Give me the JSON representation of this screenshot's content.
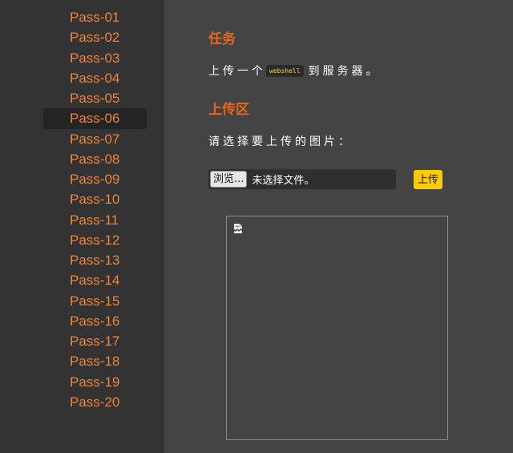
{
  "sidebar": {
    "items": [
      {
        "label": "Pass-01"
      },
      {
        "label": "Pass-02"
      },
      {
        "label": "Pass-03"
      },
      {
        "label": "Pass-04"
      },
      {
        "label": "Pass-05"
      },
      {
        "label": "Pass-06",
        "active": true
      },
      {
        "label": "Pass-07"
      },
      {
        "label": "Pass-08"
      },
      {
        "label": "Pass-09"
      },
      {
        "label": "Pass-10"
      },
      {
        "label": "Pass-11"
      },
      {
        "label": "Pass-12"
      },
      {
        "label": "Pass-13"
      },
      {
        "label": "Pass-14"
      },
      {
        "label": "Pass-15"
      },
      {
        "label": "Pass-16"
      },
      {
        "label": "Pass-17"
      },
      {
        "label": "Pass-18"
      },
      {
        "label": "Pass-19"
      },
      {
        "label": "Pass-20"
      }
    ]
  },
  "task": {
    "title": "任务",
    "text_before": "上传一个",
    "code": "webshell",
    "text_after": "到服务器。"
  },
  "upload": {
    "title": "上传区",
    "prompt": "请选择要上传的图片：",
    "browse_label": "浏览...",
    "file_status": "未选择文件。",
    "submit_label": "上传"
  },
  "preview": {
    "icon": "broken-image-icon"
  },
  "colors": {
    "nav_text": "#f0853a",
    "heading": "#e8661b",
    "upload_button": "#ffcc00",
    "code_text": "#f2d15a"
  }
}
